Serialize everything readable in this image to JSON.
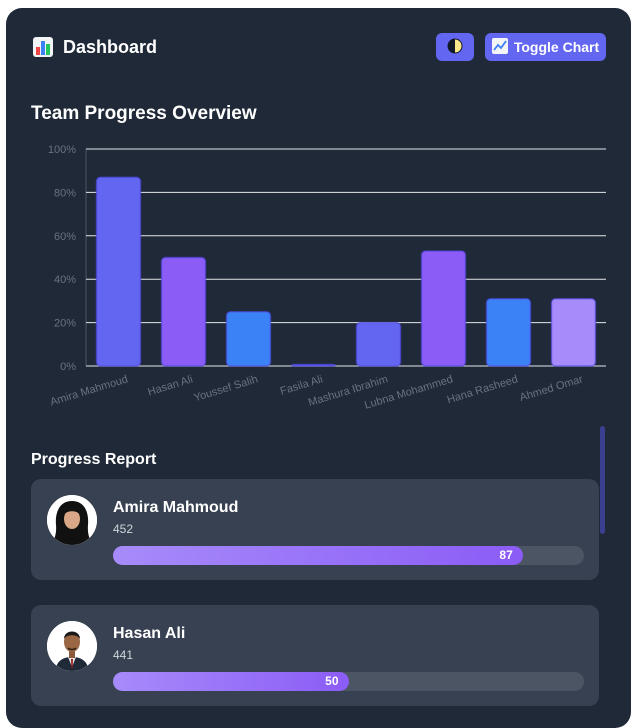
{
  "header": {
    "title": "Dashboard",
    "app_icon": "bar-chart-icon",
    "theme_button_icon": "half-circle-contrast-icon",
    "toggle_label": "Toggle Chart",
    "toggle_icon": "line-chart-icon"
  },
  "overview": {
    "title": "Team Progress Overview"
  },
  "chart_data": {
    "type": "bar",
    "categories": [
      "Amira Mahmoud",
      "Hasan Ali",
      "Youssef Salih",
      "Fasila Ali",
      "Mashura Ibrahim",
      "Lubna Mohammed",
      "Hana Rasheed",
      "Ahmed Omar"
    ],
    "values": [
      87,
      50,
      25,
      0,
      20,
      53,
      31,
      31
    ],
    "colors": [
      "#6366f1",
      "#8b5cf6",
      "#3b82f6",
      "#6366f1",
      "#6366f1",
      "#8b5cf6",
      "#3b82f6",
      "#a78bfa"
    ],
    "ylim": [
      0,
      100
    ],
    "yticks": [
      "0%",
      "20%",
      "40%",
      "60%",
      "80%",
      "100%"
    ],
    "grid": true,
    "title": "",
    "xlabel": "",
    "ylabel": ""
  },
  "report": {
    "title": "Progress Report",
    "cards": [
      {
        "name": "Amira Mahmoud",
        "value": "452",
        "progress": 87,
        "progress_label": "87",
        "avatar": "avatar-hijab-woman"
      },
      {
        "name": "Hasan Ali",
        "value": "441",
        "progress": 50,
        "progress_label": "50",
        "avatar": "avatar-man-suit"
      }
    ]
  }
}
